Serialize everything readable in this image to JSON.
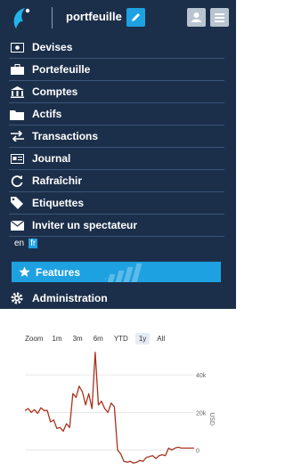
{
  "header": {
    "title": "portfeuille"
  },
  "menu": [
    {
      "label": "Devises",
      "icon": "banknote-icon"
    },
    {
      "label": "Portefeuille",
      "icon": "briefcase-icon"
    },
    {
      "label": "Comptes",
      "icon": "bank-icon"
    },
    {
      "label": "Actifs",
      "icon": "folder-icon"
    },
    {
      "label": "Transactions",
      "icon": "transfer-arrows-icon"
    },
    {
      "label": "Journal",
      "icon": "journal-icon"
    },
    {
      "label": "Rafraîchir",
      "icon": "refresh-icon"
    },
    {
      "label": "Etiquettes",
      "icon": "tag-icon"
    },
    {
      "label": "Inviter un spectateur",
      "icon": "envelope-icon"
    }
  ],
  "lang": {
    "option1": "en",
    "option2": "fr",
    "selected": "fr"
  },
  "features": {
    "label": "Features"
  },
  "admin": {
    "label": "Administration"
  },
  "zoom": {
    "label": "Zoom",
    "buttons": [
      "1m",
      "3m",
      "6m",
      "YTD",
      "1y",
      "All"
    ],
    "active": "1y"
  },
  "chart_data": {
    "type": "line",
    "ylabel": "USD",
    "ylim": [
      -4000,
      50000
    ],
    "yticks": [
      "0",
      "20k",
      "40k"
    ],
    "yticks_values": [
      0,
      20000,
      40000
    ],
    "grid": true,
    "series": [
      {
        "values": [
          21000,
          22000,
          20000,
          21500,
          19500,
          22500,
          21000,
          21000,
          15000,
          16000,
          11500,
          12000,
          10000,
          14000,
          12000,
          30000,
          28000,
          34000,
          31000,
          24000,
          30000,
          22000,
          52000,
          24000,
          26000,
          22000,
          20000,
          25000,
          23000,
          0,
          -2000,
          -6000,
          -6500,
          -6000,
          -7000,
          -6500,
          -5500,
          -6000,
          -4000,
          -3500,
          -3000,
          -4500,
          -3000,
          -2500,
          -3000,
          1000,
          0,
          1000,
          1500,
          1000,
          1000,
          1000,
          1000,
          1000
        ]
      }
    ],
    "line_color": "#a8321e"
  }
}
